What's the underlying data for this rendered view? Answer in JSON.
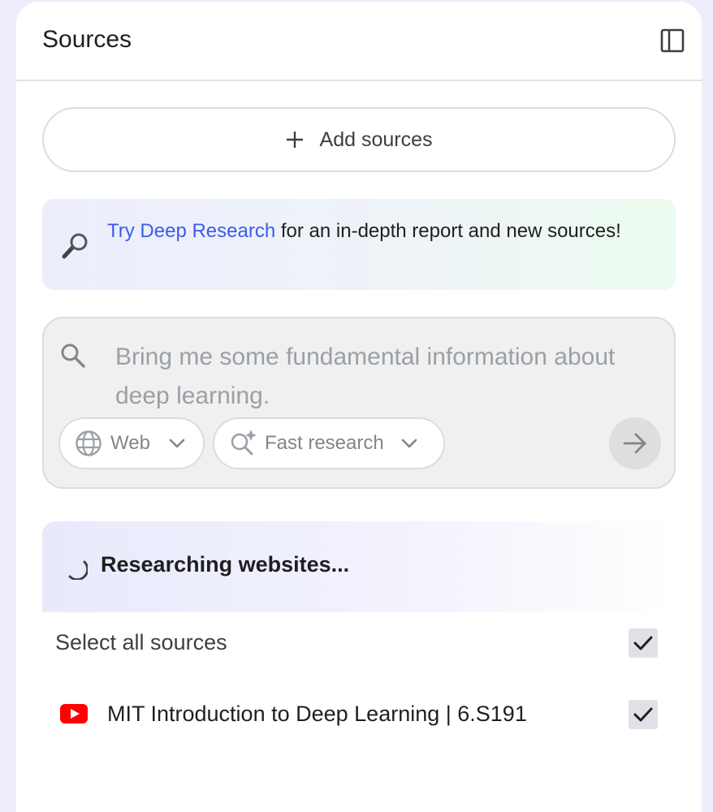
{
  "header": {
    "title": "Sources",
    "toggle_icon": "sidebar-panel-icon"
  },
  "add_sources": {
    "label": "Add sources",
    "icon": "plus-icon"
  },
  "promo": {
    "link_text": "Try Deep Research",
    "text": " for an in-depth report and new sources!",
    "icon": "magnifying-glass-icon"
  },
  "search": {
    "query": "Bring me some fundamental information about deep learning.",
    "source_chip": {
      "label": "Web",
      "icon": "globe-icon"
    },
    "mode_chip": {
      "label": "Fast research",
      "icon": "sparkle-search-icon"
    },
    "submit_icon": "arrow-right-icon"
  },
  "status": {
    "text": "Researching websites...",
    "icon": "spinner-icon"
  },
  "select_all": {
    "label": "Select all sources",
    "checked": true
  },
  "sources": [
    {
      "title": "MIT Introduction to Deep Learning | 6.S191",
      "type": "youtube",
      "checked": true
    }
  ],
  "colors": {
    "background": "#eeeefb",
    "link": "#3b5ce9",
    "youtube": "#ff0000"
  }
}
